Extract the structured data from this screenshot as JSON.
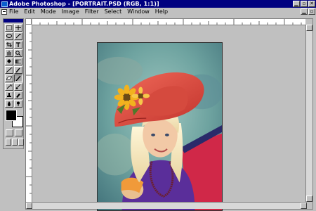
{
  "window": {
    "title": "Adobe Photoshop - [PORTRAIT.PSD (RGB, 1:1)]",
    "app_icon": "photoshop-app-icon"
  },
  "menu": {
    "items": [
      "File",
      "Edit",
      "Mode",
      "Image",
      "Filter",
      "Select",
      "Window",
      "Help"
    ]
  },
  "toolbox": {
    "foreground_color": "#000000",
    "background_color": "#ffffff"
  },
  "document": {
    "name": "PORTRAIT.PSD",
    "mode": "RGB",
    "zoom": "1:1"
  },
  "colors": {
    "title_bar": "#000080",
    "chrome": "#c0c0c0"
  }
}
